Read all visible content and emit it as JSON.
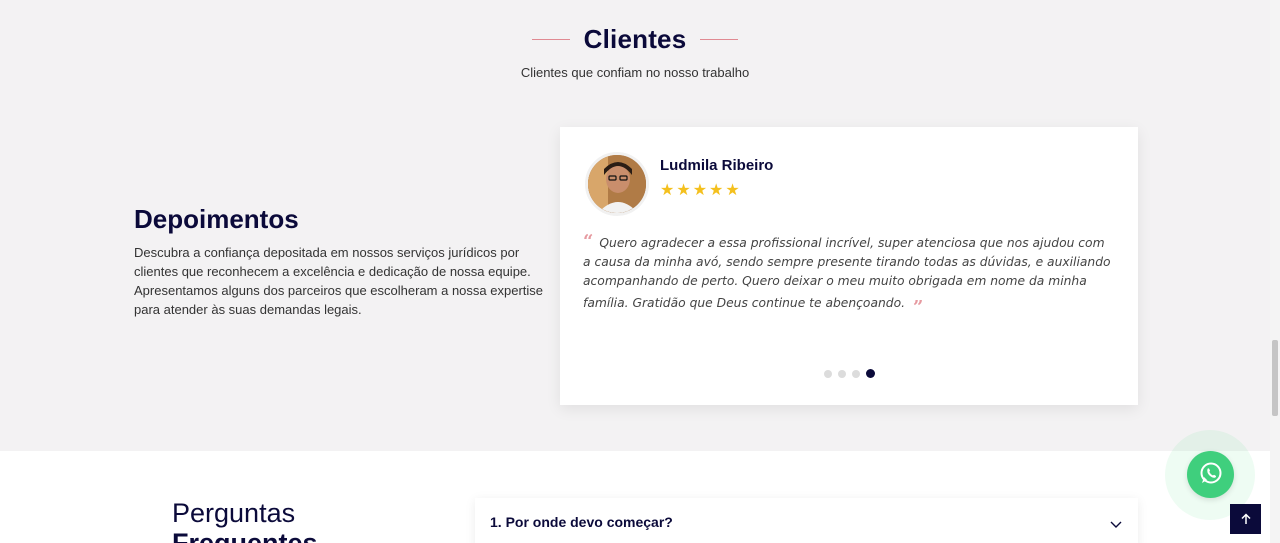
{
  "clients_section": {
    "title": "Clientes",
    "subtitle": "Clientes que confiam no nosso trabalho"
  },
  "testimonials_intro": {
    "heading": "Depoimentos",
    "text": "Descubra a confiança depositada em nossos serviços jurídicos por clientes que reconhecem a excelência e dedicação de nossa equipe. Apresentamos alguns dos parceiros que escolheram a nossa expertise para atender às suas demandas legais."
  },
  "testimonial": {
    "name": "Ludmila Ribeiro",
    "rating": 5,
    "quote": "Quero agradecer a essa profissional incrível, super atenciosa que nos ajudou com a causa da minha avó, sendo sempre presente tirando todas as dúvidas, e auxiliando acompanhando de perto. Quero deixar o meu muito obrigada em nome da minha família. Gratidão que Deus continue te abençoando.",
    "slides_total": 4,
    "active_slide": 4
  },
  "faq": {
    "title_line1": "Perguntas",
    "title_line2": "Frequentes",
    "items": [
      {
        "question": "1. Por onde devo começar?"
      }
    ]
  },
  "floating": {
    "whatsapp_icon": "whatsapp-icon",
    "back_to_top_icon": "arrow-up-icon"
  },
  "colors": {
    "navy": "#0b0a3a",
    "accent_pink": "#e08a92",
    "star": "#f4c01e",
    "whatsapp": "#3fcf7d"
  }
}
